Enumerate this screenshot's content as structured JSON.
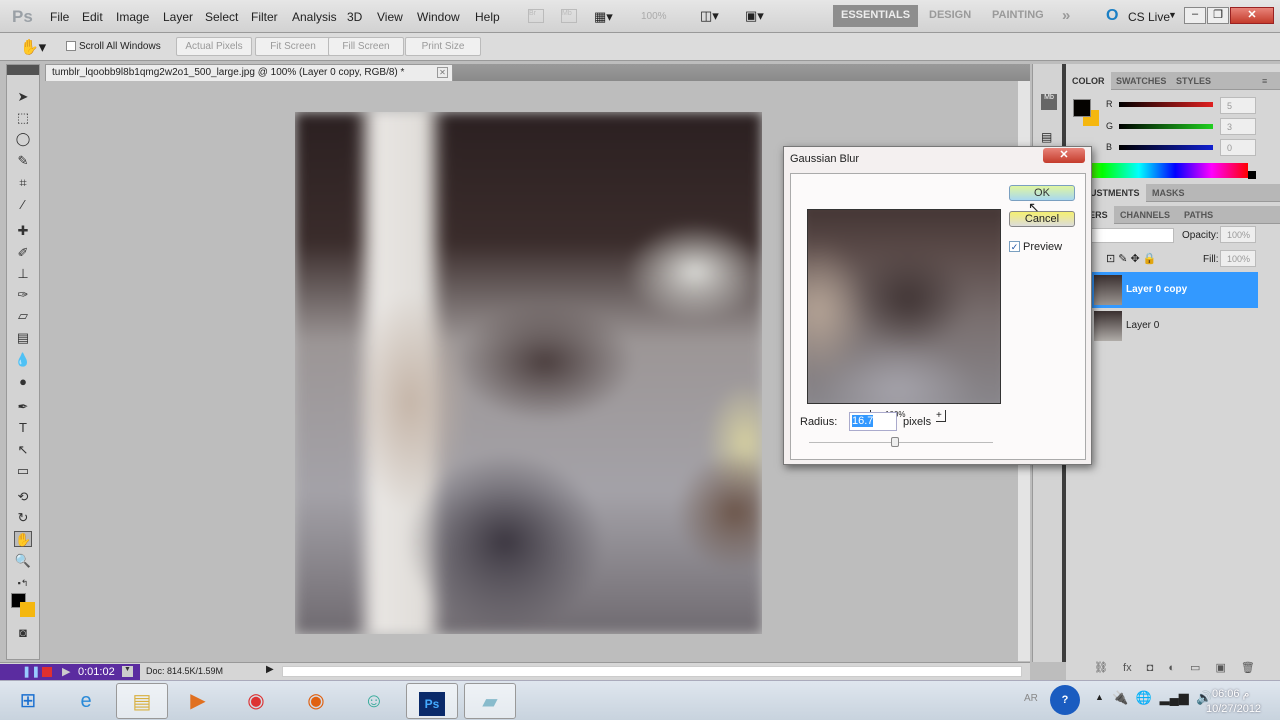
{
  "app": {
    "logo": "Ps",
    "menu": [
      "File",
      "Edit",
      "Image",
      "Layer",
      "Select",
      "Filter",
      "Analysis",
      "3D",
      "View",
      "Window",
      "Help"
    ],
    "zoom": "100%",
    "workspaces": [
      "ESSENTIALS",
      "DESIGN",
      "PAINTING"
    ],
    "more": "»",
    "cs_live": "CS Live"
  },
  "options": {
    "scroll_all": "Scroll All Windows",
    "buttons": [
      "Actual Pixels",
      "Fit Screen",
      "Fill Screen",
      "Print Size"
    ]
  },
  "document": {
    "tab_title": "tumblr_lqoobb9l8b1qmg2w2o1_500_large.jpg @ 100% (Layer 0 copy, RGB/8) *",
    "status": "Doc: 814.5K/1.59M"
  },
  "recorder": {
    "time": "0:01:02"
  },
  "color_panel": {
    "tabs": [
      "COLOR",
      "SWATCHES",
      "STYLES"
    ],
    "channels": [
      {
        "label": "R",
        "value": "5"
      },
      {
        "label": "G",
        "value": "3"
      },
      {
        "label": "B",
        "value": "0"
      }
    ],
    "foreground": "#050300",
    "background": "#f5b70f"
  },
  "adjust_panel": {
    "tabs": [
      "ADJUSTMENTS",
      "MASKS"
    ]
  },
  "layers_panel": {
    "tabs": [
      "LAYERS",
      "CHANNELS",
      "PATHS"
    ],
    "opacity_label": "Opacity:",
    "opacity": "100%",
    "fill_label": "Fill:",
    "fill": "100%",
    "layers": [
      {
        "name": "Layer 0 copy",
        "selected": true
      },
      {
        "name": "Layer 0",
        "selected": false
      }
    ]
  },
  "dialog": {
    "title": "Gaussian Blur",
    "ok": "OK",
    "cancel": "Cancel",
    "preview_label": "Preview",
    "preview_checked": true,
    "zoom": "100%",
    "zoom_out": "-",
    "zoom_in": "+",
    "radius_label": "Radius:",
    "radius": "16.7",
    "unit": "pixels",
    "slider_fraction": 0.47
  },
  "taskbar": {
    "lang": "AR",
    "time": "06:06 م",
    "date": "10/27/2012",
    "ps_label": "Ps"
  }
}
